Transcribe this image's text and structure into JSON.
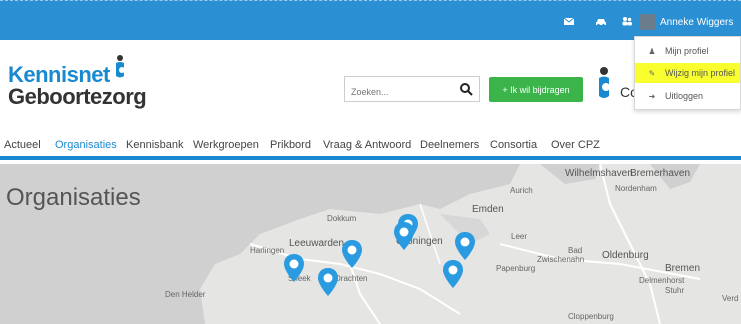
{
  "topbar": {
    "icons": [
      "envelope-icon",
      "car-icon",
      "group-icon"
    ],
    "user_name": "Anneke Wiggers"
  },
  "user_menu": {
    "items": [
      {
        "label": "Mijn profiel",
        "icon": "user-icon"
      },
      {
        "label": "Wijzig mijn profiel",
        "icon": "edit-icon",
        "highlighted": true
      },
      {
        "label": "Uitloggen",
        "icon": "logout-icon"
      }
    ]
  },
  "header": {
    "logo_line1": "Kennisnet",
    "logo_line2": "Geboortezorg",
    "search_placeholder": "Zoeken...",
    "cta_label": "+ Ik wil bijdragen",
    "cpz_text": "Co"
  },
  "nav": {
    "items": [
      "Actueel",
      "Organisaties",
      "Kennisbank",
      "Werkgroepen",
      "Prikbord",
      "Vraag & Antwoord",
      "Deelnemers",
      "Consortia",
      "Over CPZ"
    ],
    "active_index": 1
  },
  "map": {
    "title": "Organisaties",
    "labels": [
      "Wilhelmshaven",
      "Bremerhaven",
      "Nordenham",
      "Aurich",
      "Emden",
      "Dokkum",
      "Leeuwarden",
      "Harlingen",
      "Groningen",
      "Leer",
      "Bad",
      "Zwischenahn",
      "Oldenburg",
      "Papenburg",
      "Bremen",
      "Delmenhorst",
      "Stuhr",
      "Verd",
      "Den Helder",
      "Sneek",
      "Drachten",
      "Cloppenburg"
    ],
    "pin_color": "#2a9be0"
  },
  "colors": {
    "brand_blue": "#1a8ad0",
    "topbar_blue": "#2a8fd3",
    "cta_green": "#3bb54a",
    "highlight_yellow": "#f9ff2e"
  }
}
